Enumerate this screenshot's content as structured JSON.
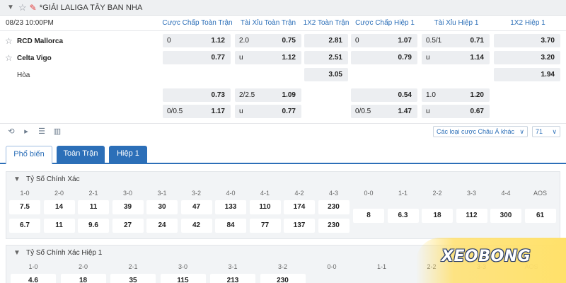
{
  "league": {
    "title": "*GIẢI LALIGA TÂY BAN NHA"
  },
  "match": {
    "time": "08/23 10:00PM",
    "columns": [
      "Cược Chấp Toàn Trận",
      "Tài Xỉu Toàn Trận",
      "1X2 Toàn Trận",
      "Cược Chấp Hiệp 1",
      "Tài Xỉu Hiệp 1",
      "1X2 Hiệp 1"
    ],
    "home": "RCD Mallorca",
    "away": "Celta Vigo",
    "draw": "Hòa",
    "main": {
      "home": {
        "ah_line": "0",
        "ah_odd": "1.12",
        "ou_line": "2.0",
        "ou_odd": "0.75",
        "x12": "2.81",
        "h1_ah_line": "0",
        "h1_ah_odd": "1.07",
        "h1_ou_line": "0.5/1",
        "h1_ou_odd": "0.71",
        "h1_x12": "3.70"
      },
      "away": {
        "ah_line": "",
        "ah_odd": "0.77",
        "ou_line": "u",
        "ou_odd": "1.12",
        "x12": "2.51",
        "h1_ah_line": "",
        "h1_ah_odd": "0.79",
        "h1_ou_line": "u",
        "h1_ou_odd": "1.14",
        "h1_x12": "3.20"
      },
      "draw": {
        "x12": "3.05",
        "h1_x12": "1.94"
      }
    },
    "alt": {
      "home": {
        "ah_line": "",
        "ah_odd": "0.73",
        "ou_line": "2/2.5",
        "ou_odd": "1.09",
        "h1_ah_line": "",
        "h1_ah_odd": "0.54",
        "h1_ou_line": "1.0",
        "h1_ou_odd": "1.20"
      },
      "away": {
        "ah_line": "0/0.5",
        "ah_odd": "1.17",
        "ou_line": "u",
        "ou_odd": "0.77",
        "h1_ah_line": "0/0.5",
        "h1_ah_odd": "1.47",
        "h1_ou_line": "u",
        "h1_ou_odd": "0.67"
      }
    }
  },
  "toolbar": {
    "icons": [
      "replay-icon",
      "play-icon",
      "list-icon",
      "stats-icon"
    ],
    "odds_type": "Các loại cược Châu Á khác",
    "count": "71"
  },
  "tabs": [
    {
      "label": "Phổ biến",
      "state": "active"
    },
    {
      "label": "Toàn Trận",
      "state": "blue"
    },
    {
      "label": "Hiệp 1",
      "state": "blue"
    }
  ],
  "correct_score": {
    "title": "Tỷ Số Chính Xác",
    "left_labels": [
      "1-0",
      "2-0",
      "2-1",
      "3-0",
      "3-1",
      "3-2",
      "4-0",
      "4-1",
      "4-2",
      "4-3"
    ],
    "left_row1": [
      "7.5",
      "14",
      "11",
      "39",
      "30",
      "47",
      "133",
      "110",
      "174",
      "230"
    ],
    "left_row2": [
      "6.7",
      "11",
      "9.6",
      "27",
      "24",
      "42",
      "84",
      "77",
      "137",
      "230"
    ],
    "right_labels": [
      "0-0",
      "1-1",
      "2-2",
      "3-3",
      "4-4",
      "AOS"
    ],
    "right_values": [
      "8",
      "6.3",
      "18",
      "112",
      "300",
      "61"
    ]
  },
  "correct_score_h1": {
    "title": "Tỷ Số Chính Xác Hiệp 1",
    "left_labels": [
      "1-0",
      "2-0",
      "2-1",
      "3-0",
      "3-1",
      "3-2"
    ],
    "left_row1": [
      "4.6",
      "18",
      "35",
      "115",
      "213",
      "230"
    ],
    "right_labels": [
      "0-0",
      "1-1",
      "2-2",
      "3-3",
      "AOS"
    ]
  },
  "watermark": {
    "text": "XEOBONG"
  },
  "colors": {
    "accent": "#2c6fb8",
    "cell_bg": "#eceef1",
    "pin": "#e23b3b",
    "watermark": "#ffe16a"
  }
}
